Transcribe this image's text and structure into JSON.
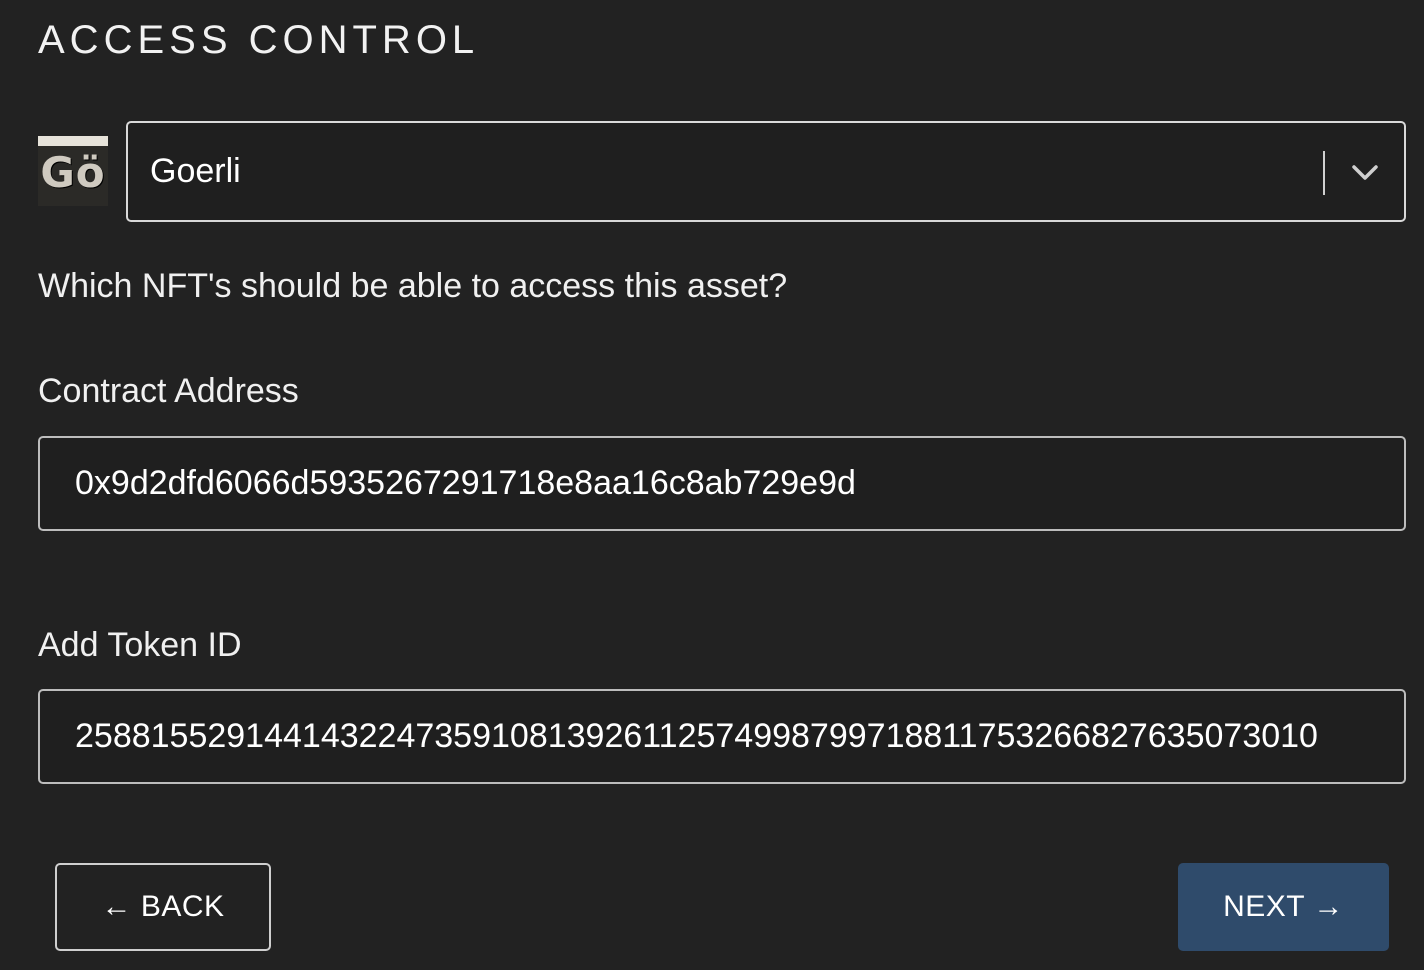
{
  "page": {
    "title": "ACCESS CONTROL"
  },
  "network": {
    "logo_text": "Gö",
    "selected": "Goerli",
    "icon": "chevron-down-icon"
  },
  "question": "Which NFT's should be able to access this asset?",
  "contract": {
    "label": "Contract Address",
    "value": "0x9d2dfd6066d5935267291718e8aa16c8ab729e9d"
  },
  "token": {
    "label": "Add Token ID",
    "value": "258815529144143224735910813926112574998799718811753266827635073010"
  },
  "buttons": {
    "back_label": "← BACK",
    "next_label": "NEXT →"
  },
  "colors": {
    "background": "#222222",
    "next_button": "#2f4b6b",
    "border": "#d9d9d9"
  }
}
